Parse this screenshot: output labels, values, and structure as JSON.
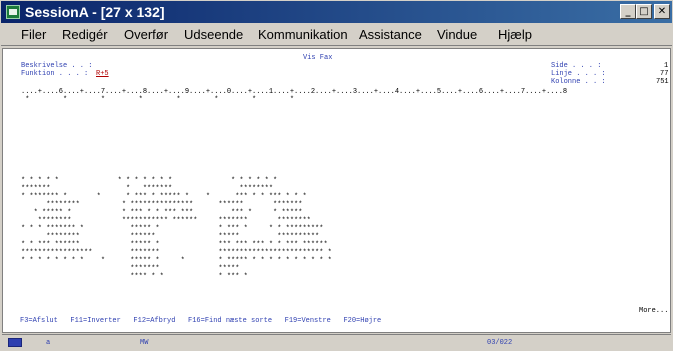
{
  "window": {
    "title": "SessionA - [27 x 132]",
    "minimize_glyph": "_",
    "maximize_glyph": "□",
    "close_glyph": "✕"
  },
  "menu": {
    "items": [
      {
        "label": "Filer"
      },
      {
        "label": "Redigér"
      },
      {
        "label": "Overfør"
      },
      {
        "label": "Udseende"
      },
      {
        "label": "Kommunikation"
      },
      {
        "label": "Assistance"
      },
      {
        "label": "Vindue"
      },
      {
        "label": "Hjælp"
      }
    ]
  },
  "terminal": {
    "screen_title": "Vis Fax",
    "beskrivelse_label": "Beskrivelse . . :",
    "funktion_label": "Funktion . . . :",
    "funktion_value": "R+5",
    "side_label": "Side . . . :",
    "side_value": "1",
    "linje_label": "Linje . . . :",
    "linje_value": "77",
    "kolonne_label": "Kolonne . . :",
    "kolonne_value": "751",
    "ruler": "....+....6....+....7....+....8....+....9....+....0....+....1....+....2....+....3....+....4....+....5....+....6....+....7....+....8",
    "ruler_marks": " *        *        *        *        *        *        *        *",
    "fax_lines": [
      "* * * * *              * * * * * * *              * * * * * *",
      "*******                  *   *******                ********",
      "* ******* *       *      * *** * ***** *    *      *** * * *** * * *",
      "      ********          * ***************      ******       *******",
      "   * ***** *            * *** * * *** ***         *** *     * *****",
      "    ********            *********** ******     *******       ********",
      "* * * ******* *           ***** *              * *** *     * * *********",
      "      ********            ******               *****         **********",
      "* * *** ******            ***** *              *** *** *** * * *** ******",
      "*****************         *******              ************************* *",
      "* * * * * * * *    *      ***** *     *        * ***** * * * * * * * * * *",
      "                          *******              *****",
      "                          **** * *             * *** *"
    ],
    "more": "More...",
    "function_keys": "F3=Afslut   F11=Inverter   F12=Afbryd   F16=Find næste sorte   F19=Venstre   F20=Højre"
  },
  "status": {
    "session_letter": "a",
    "mode": "MW",
    "cursor_pos": "03/022"
  }
}
